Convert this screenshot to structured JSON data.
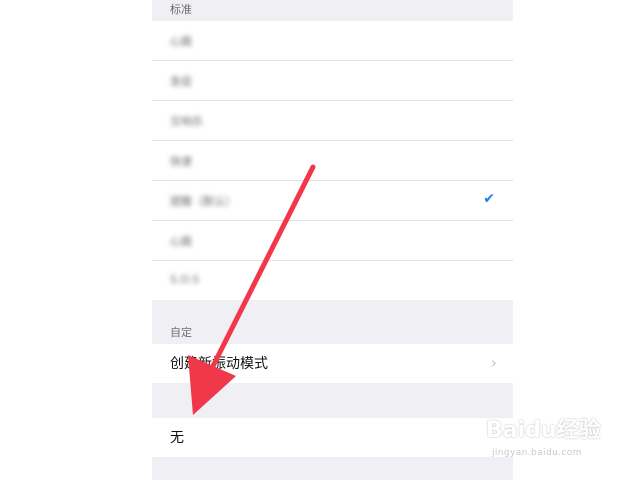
{
  "sections": {
    "standard": {
      "header": "标准",
      "items": [
        {
          "label": "心跳",
          "checked": false
        },
        {
          "label": "急促",
          "checked": false
        },
        {
          "label": "交响乐",
          "checked": false
        },
        {
          "label": "快速",
          "checked": false
        },
        {
          "label": "提醒（默认）",
          "checked": true
        },
        {
          "label": "心跳",
          "checked": false
        },
        {
          "label": "S.O.S",
          "checked": false
        }
      ]
    },
    "custom": {
      "header": "自定",
      "create_label": "创建新振动模式"
    },
    "none": {
      "label": "无"
    }
  },
  "watermark": {
    "brand": "Baidu经验",
    "url": "jingyan.baidu.com"
  },
  "colors": {
    "accent": "#1a7cf0",
    "arrow": "#f0384a",
    "background": "#efeff4"
  },
  "icons": {
    "checkmark": "checkmark-icon",
    "chevron": "chevron-right-icon",
    "arrow": "red-annotation-arrow"
  }
}
